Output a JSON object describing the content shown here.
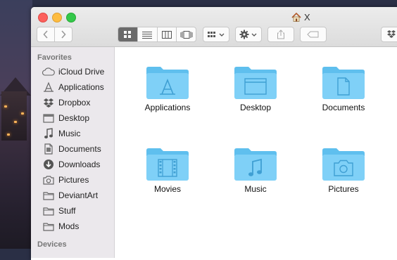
{
  "window": {
    "title": "X"
  },
  "sidebar": {
    "favorites_header": "Favorites",
    "items": [
      {
        "label": "iCloud Drive",
        "icon": "cloud-icon"
      },
      {
        "label": "Applications",
        "icon": "applications-icon"
      },
      {
        "label": "Dropbox",
        "icon": "dropbox-icon"
      },
      {
        "label": "Desktop",
        "icon": "desktop-icon"
      },
      {
        "label": "Music",
        "icon": "music-icon"
      },
      {
        "label": "Documents",
        "icon": "document-icon"
      },
      {
        "label": "Downloads",
        "icon": "download-icon"
      },
      {
        "label": "Pictures",
        "icon": "camera-icon"
      },
      {
        "label": "DeviantArt",
        "icon": "folder-icon"
      },
      {
        "label": "Stuff",
        "icon": "folder-icon"
      },
      {
        "label": "Mods",
        "icon": "folder-icon"
      }
    ],
    "devices_header": "Devices"
  },
  "folders": [
    {
      "label": "Applications",
      "glyph": "applications-glyph"
    },
    {
      "label": "Desktop",
      "glyph": "desktop-glyph"
    },
    {
      "label": "Documents",
      "glyph": "document-glyph"
    },
    {
      "label": "Movies",
      "glyph": "film-glyph"
    },
    {
      "label": "Music",
      "glyph": "music-glyph"
    },
    {
      "label": "Pictures",
      "glyph": "camera-glyph"
    }
  ],
  "colors": {
    "folder_light": "#7fd0f7",
    "folder_dark": "#5fbfee",
    "glyph": "#3f9fd3"
  }
}
